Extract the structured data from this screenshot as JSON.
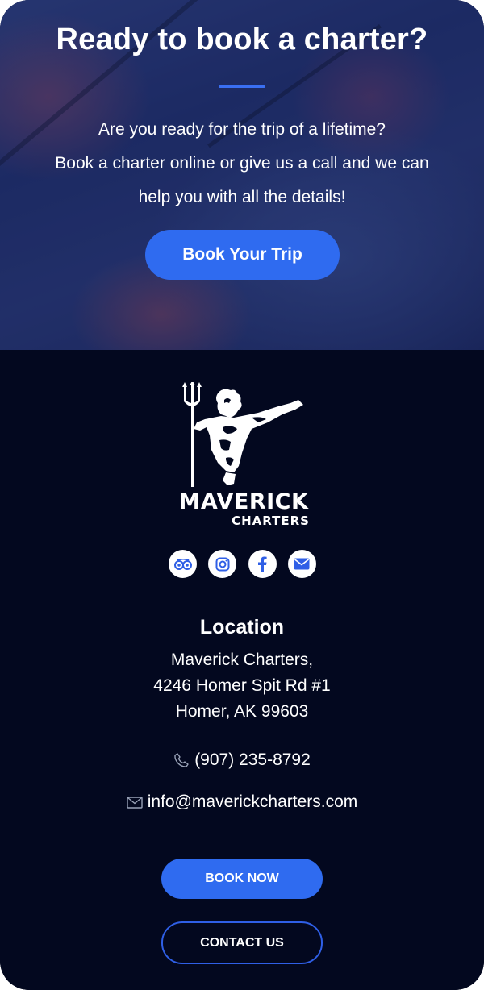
{
  "hero": {
    "title": "Ready to book a charter?",
    "line1": "Are you ready for the trip of a lifetime?",
    "line2": "Book a charter online or give us a call and we can",
    "line3": "help you with all the details!",
    "button": "Book Your Trip"
  },
  "logo": {
    "word1": "MAVERICK",
    "word2": "CHARTERS"
  },
  "socials": [
    {
      "icon": "tripadvisor-icon"
    },
    {
      "icon": "instagram-icon"
    },
    {
      "icon": "facebook-icon"
    },
    {
      "icon": "email-icon"
    }
  ],
  "location": {
    "title": "Location",
    "line1": "Maverick Charters,",
    "line2": "4246 Homer Spit Rd #1",
    "line3": "Homer, AK 99603"
  },
  "contact": {
    "phone": "(907) 235-8792",
    "email": "info@maverickcharters.com"
  },
  "buttons": {
    "book": "BOOK NOW",
    "contact": "CONTACT US"
  },
  "colors": {
    "accent": "#2f6bf0",
    "footer_bg": "#03081f"
  }
}
